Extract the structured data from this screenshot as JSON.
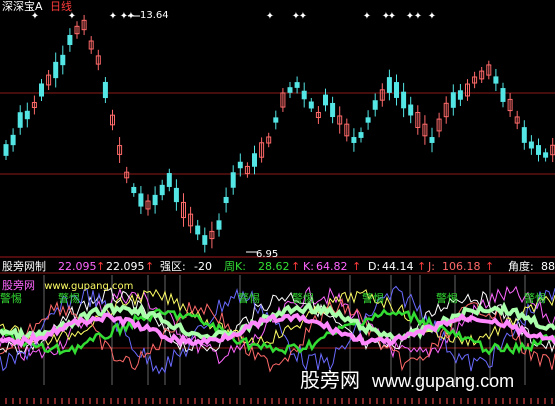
{
  "header": {
    "stock_name": "深深宝A",
    "period": "日线"
  },
  "price_chart": {
    "high_label": "13.64",
    "low_label": "6.95",
    "marker_glyph": "✦",
    "colors": {
      "up": "#ff6a6a",
      "down": "#54e5e5",
      "grid": "#8b1a1a",
      "marker": "#ffffff"
    }
  },
  "indicator_bar": {
    "name": "股旁网制",
    "v1": "22.095",
    "v2": "22.095",
    "qiangqu_label": "强区:",
    "qiangqu_value": "-20",
    "zhouK_label": "周K:",
    "zhouK_value": "28.62",
    "k_label": "K:",
    "k_value": "64.82",
    "d_label": "D:",
    "d_value": "44.14",
    "j_label": "J:",
    "j_value": "106.18",
    "jiaodu_label": "角度:",
    "jiaodu_value": "88"
  },
  "sub_chart": {
    "site_name": "股旁网",
    "site_url": "www.gupang.com",
    "warning_label": "警惕"
  },
  "watermark": {
    "site": "股旁网",
    "url": "www.gupang.com"
  }
}
